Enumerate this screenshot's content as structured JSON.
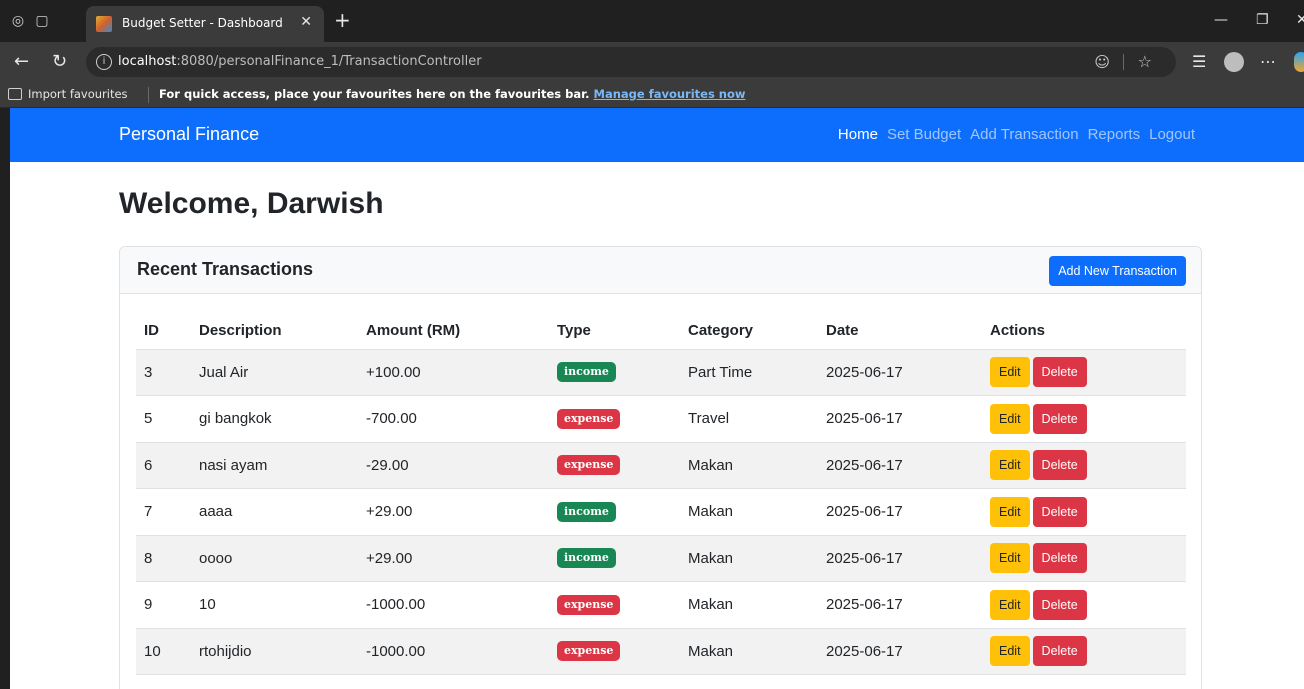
{
  "browser": {
    "tab_title": "Budget Setter - Dashboard",
    "close_glyph": "✕",
    "new_tab_glyph": "+",
    "url_host": "localhost",
    "url_rest": ":8080/personalFinance_1/TransactionController",
    "favbar_import": "Import favourites",
    "favbar_message": "For quick access, place your favourites here on the favourites bar.",
    "favbar_link": "Manage favourites now"
  },
  "navbar": {
    "brand": "Personal Finance",
    "links": [
      "Home",
      "Set Budget",
      "Add Transaction",
      "Reports",
      "Logout"
    ]
  },
  "page": {
    "welcome": "Welcome, Darwish",
    "card_title": "Recent Transactions",
    "add_button": "Add New Transaction"
  },
  "table": {
    "headers": [
      "ID",
      "Description",
      "Amount (RM)",
      "Type",
      "Category",
      "Date",
      "Actions"
    ],
    "edit_label": "Edit",
    "delete_label": "Delete",
    "rows": [
      {
        "id": "3",
        "description": "Jual Air",
        "amount": "+100.00",
        "type": "income",
        "category": "Part Time",
        "date": "2025-06-17"
      },
      {
        "id": "5",
        "description": "gi bangkok",
        "amount": "-700.00",
        "type": "expense",
        "category": "Travel",
        "date": "2025-06-17"
      },
      {
        "id": "6",
        "description": "nasi ayam",
        "amount": "-29.00",
        "type": "expense",
        "category": "Makan",
        "date": "2025-06-17"
      },
      {
        "id": "7",
        "description": "aaaa",
        "amount": "+29.00",
        "type": "income",
        "category": "Makan",
        "date": "2025-06-17"
      },
      {
        "id": "8",
        "description": "oooo",
        "amount": "+29.00",
        "type": "income",
        "category": "Makan",
        "date": "2025-06-17"
      },
      {
        "id": "9",
        "description": "10",
        "amount": "-1000.00",
        "type": "expense",
        "category": "Makan",
        "date": "2025-06-17"
      },
      {
        "id": "10",
        "description": "rtohijdio",
        "amount": "-1000.00",
        "type": "expense",
        "category": "Makan",
        "date": "2025-06-17"
      }
    ]
  },
  "colors": {
    "primary": "#0d6efd",
    "income": "#198754",
    "expense": "#dc3545",
    "warning": "#ffc107"
  }
}
